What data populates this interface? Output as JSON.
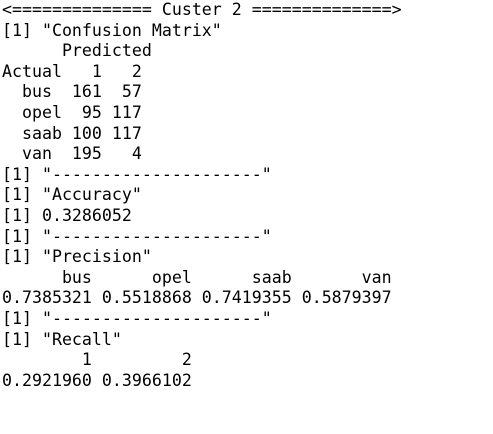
{
  "console": {
    "lines": [
      "<============== Custer 2 ==============>",
      "[1] \"Confusion Matrix\"",
      "      Predicted",
      "Actual   1   2",
      "  bus  161  57",
      "  opel  95 117",
      "  saab 100 117",
      "  van  195   4",
      "[1] \"---------------------\"",
      "[1] \"Accuracy\"",
      "[1] 0.3286052",
      "[1] \"---------------------\"",
      "[1] \"Precision\"",
      "      bus      opel      saab       van",
      "0.7385321 0.5518868 0.7419355 0.5879397",
      "[1] \"---------------------\"",
      "[1] \"Recall\"",
      "        1         2",
      "0.2921960 0.3966102"
    ]
  }
}
